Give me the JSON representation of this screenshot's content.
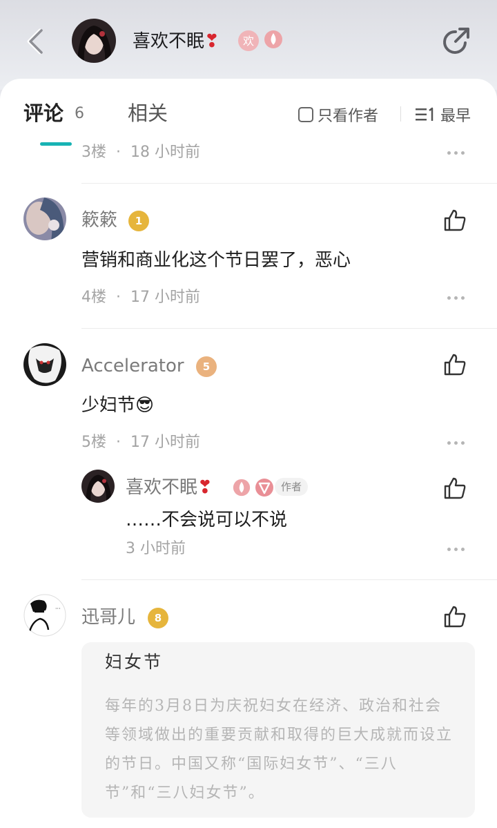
{
  "header": {
    "title_name": "喜欢不眠",
    "title_heart": "❣",
    "badge_ribbon_text": "欢"
  },
  "tabs": {
    "comments_label": "评论",
    "comments_count": "6",
    "related_label": "相关",
    "author_only_label": "只看作者",
    "sort_label": "最早"
  },
  "comments": [
    {
      "floor_meta": "3楼  ·  18 小时前"
    },
    {
      "username": "簌簌",
      "level": "1",
      "text": "营销和商业化这个节日罢了，恶心",
      "floor_meta": "4楼  ·  17 小时前"
    },
    {
      "username": "Accelerator",
      "level": "5",
      "text": "少妇节😎",
      "floor_meta": "5楼  ·  17 小时前",
      "reply": {
        "username": "喜欢不眠",
        "heart": "❣",
        "author_tag": "作者",
        "text": "……不会说可以不说",
        "time": "3 小时前"
      }
    },
    {
      "username": "迅哥儿",
      "level": "8",
      "card": {
        "title": "妇女节",
        "body": "每年的3月8日为庆祝妇女在经济、政治和社会等领域做出的重要贡献和取得的巨大成就而设立的节日。中国又称“国际妇女节”、“三八节”和“三八妇女节”。"
      }
    }
  ],
  "colors": {
    "accent": "#18b3b4",
    "level_gold": "#e6b53c",
    "level_peach": "#eab27e",
    "heart_red": "#d8262e"
  }
}
